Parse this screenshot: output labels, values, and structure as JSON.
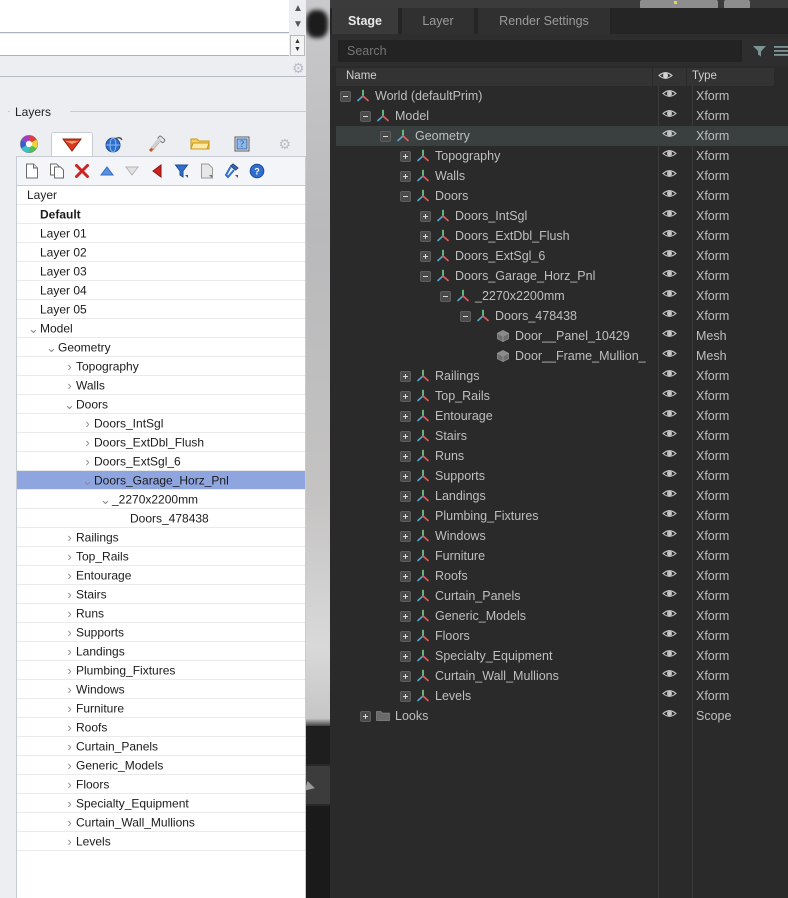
{
  "background": {
    "topbar_button_label": "",
    "secondary_button_label": ""
  },
  "left_panel": {
    "group_title": "Layers",
    "tabs": [
      {
        "name": "color-wheel-tab",
        "icon": "color-wheel-icon",
        "active": false
      },
      {
        "name": "layers-tab",
        "icon": "layers-shield-icon",
        "active": true
      },
      {
        "name": "globe-tab",
        "icon": "globe-icon",
        "active": false
      },
      {
        "name": "paint-tab",
        "icon": "paintbrush-icon",
        "active": false
      },
      {
        "name": "folder-tab",
        "icon": "folder-icon",
        "active": false
      },
      {
        "name": "image-tab",
        "icon": "image-icon",
        "active": false
      },
      {
        "name": "settings-tab",
        "icon": "gear-icon",
        "active": false
      }
    ],
    "toolbar": [
      {
        "name": "new-layer-button",
        "icon": "page-new-icon"
      },
      {
        "name": "duplicate-layer-button",
        "icon": "page-copy-icon"
      },
      {
        "name": "delete-layer-button",
        "icon": "delete-x-icon"
      },
      {
        "name": "move-up-button",
        "icon": "triangle-up-icon"
      },
      {
        "name": "move-down-button",
        "icon": "triangle-down-icon"
      },
      {
        "name": "back-button",
        "icon": "triangle-left-icon"
      },
      {
        "name": "filter-button",
        "icon": "funnel-icon"
      },
      {
        "name": "properties-button",
        "icon": "page-properties-icon"
      },
      {
        "name": "tools-button",
        "icon": "hammer-icon"
      },
      {
        "name": "help-button",
        "icon": "help-question-icon"
      }
    ],
    "column_header": "Layer",
    "rows": [
      {
        "label": "Default",
        "depth": 0,
        "arrow": "none",
        "bold": true,
        "selected": false
      },
      {
        "label": "Layer 01",
        "depth": 0,
        "arrow": "none",
        "bold": false,
        "selected": false
      },
      {
        "label": "Layer 02",
        "depth": 0,
        "arrow": "none",
        "bold": false,
        "selected": false
      },
      {
        "label": "Layer 03",
        "depth": 0,
        "arrow": "none",
        "bold": false,
        "selected": false
      },
      {
        "label": "Layer 04",
        "depth": 0,
        "arrow": "none",
        "bold": false,
        "selected": false
      },
      {
        "label": "Layer 05",
        "depth": 0,
        "arrow": "none",
        "bold": false,
        "selected": false
      },
      {
        "label": "Model",
        "depth": 0,
        "arrow": "expanded",
        "bold": false,
        "selected": false
      },
      {
        "label": "Geometry",
        "depth": 1,
        "arrow": "expanded",
        "bold": false,
        "selected": false
      },
      {
        "label": "Topography",
        "depth": 2,
        "arrow": "collapsed",
        "bold": false,
        "selected": false
      },
      {
        "label": "Walls",
        "depth": 2,
        "arrow": "collapsed",
        "bold": false,
        "selected": false
      },
      {
        "label": "Doors",
        "depth": 2,
        "arrow": "expanded",
        "bold": false,
        "selected": false
      },
      {
        "label": "Doors_IntSgl",
        "depth": 3,
        "arrow": "collapsed",
        "bold": false,
        "selected": false
      },
      {
        "label": "Doors_ExtDbl_Flush",
        "depth": 3,
        "arrow": "collapsed",
        "bold": false,
        "selected": false
      },
      {
        "label": "Doors_ExtSgl_6",
        "depth": 3,
        "arrow": "collapsed",
        "bold": false,
        "selected": false
      },
      {
        "label": "Doors_Garage_Horz_Pnl",
        "depth": 3,
        "arrow": "expanded",
        "bold": false,
        "selected": true
      },
      {
        "label": "_2270x2200mm",
        "depth": 4,
        "arrow": "expanded",
        "bold": false,
        "selected": false
      },
      {
        "label": "Doors_478438",
        "depth": 5,
        "arrow": "none",
        "bold": false,
        "selected": false
      },
      {
        "label": "Railings",
        "depth": 2,
        "arrow": "collapsed",
        "bold": false,
        "selected": false
      },
      {
        "label": "Top_Rails",
        "depth": 2,
        "arrow": "collapsed",
        "bold": false,
        "selected": false
      },
      {
        "label": "Entourage",
        "depth": 2,
        "arrow": "collapsed",
        "bold": false,
        "selected": false
      },
      {
        "label": "Stairs",
        "depth": 2,
        "arrow": "collapsed",
        "bold": false,
        "selected": false
      },
      {
        "label": "Runs",
        "depth": 2,
        "arrow": "collapsed",
        "bold": false,
        "selected": false
      },
      {
        "label": "Supports",
        "depth": 2,
        "arrow": "collapsed",
        "bold": false,
        "selected": false
      },
      {
        "label": "Landings",
        "depth": 2,
        "arrow": "collapsed",
        "bold": false,
        "selected": false
      },
      {
        "label": "Plumbing_Fixtures",
        "depth": 2,
        "arrow": "collapsed",
        "bold": false,
        "selected": false
      },
      {
        "label": "Windows",
        "depth": 2,
        "arrow": "collapsed",
        "bold": false,
        "selected": false
      },
      {
        "label": "Furniture",
        "depth": 2,
        "arrow": "collapsed",
        "bold": false,
        "selected": false
      },
      {
        "label": "Roofs",
        "depth": 2,
        "arrow": "collapsed",
        "bold": false,
        "selected": false
      },
      {
        "label": "Curtain_Panels",
        "depth": 2,
        "arrow": "collapsed",
        "bold": false,
        "selected": false
      },
      {
        "label": "Generic_Models",
        "depth": 2,
        "arrow": "collapsed",
        "bold": false,
        "selected": false
      },
      {
        "label": "Floors",
        "depth": 2,
        "arrow": "collapsed",
        "bold": false,
        "selected": false
      },
      {
        "label": "Specialty_Equipment",
        "depth": 2,
        "arrow": "collapsed",
        "bold": false,
        "selected": false
      },
      {
        "label": "Curtain_Wall_Mullions",
        "depth": 2,
        "arrow": "collapsed",
        "bold": false,
        "selected": false
      },
      {
        "label": "Levels",
        "depth": 2,
        "arrow": "collapsed",
        "bold": false,
        "selected": false
      }
    ]
  },
  "right_panel": {
    "tabs": [
      {
        "label": "Stage",
        "active": true
      },
      {
        "label": "Layer",
        "active": false
      },
      {
        "label": "Render Settings",
        "active": false
      }
    ],
    "search": {
      "value": "",
      "placeholder": "Search"
    },
    "search_icons": [
      {
        "name": "filter-icon"
      },
      {
        "name": "options-menu-icon"
      }
    ],
    "columns": {
      "name": "Name",
      "visibility_icon": "eye-icon",
      "type": "Type"
    },
    "rows": [
      {
        "label": "World (defaultPrim)",
        "type": "Xform",
        "depth": 0,
        "expander": "minus",
        "icon": "xform-axis-icon",
        "selected": false
      },
      {
        "label": "Model",
        "type": "Xform",
        "depth": 1,
        "expander": "minus",
        "icon": "xform-axis-icon",
        "selected": false
      },
      {
        "label": "Geometry",
        "type": "Xform",
        "depth": 2,
        "expander": "minus",
        "icon": "xform-axis-icon",
        "selected": true
      },
      {
        "label": "Topography",
        "type": "Xform",
        "depth": 3,
        "expander": "plus",
        "icon": "xform-axis-icon",
        "selected": false
      },
      {
        "label": "Walls",
        "type": "Xform",
        "depth": 3,
        "expander": "plus",
        "icon": "xform-axis-icon",
        "selected": false
      },
      {
        "label": "Doors",
        "type": "Xform",
        "depth": 3,
        "expander": "minus",
        "icon": "xform-axis-icon",
        "selected": false
      },
      {
        "label": "Doors_IntSgl",
        "type": "Xform",
        "depth": 4,
        "expander": "plus",
        "icon": "xform-axis-icon",
        "selected": false
      },
      {
        "label": "Doors_ExtDbl_Flush",
        "type": "Xform",
        "depth": 4,
        "expander": "plus",
        "icon": "xform-axis-icon",
        "selected": false
      },
      {
        "label": "Doors_ExtSgl_6",
        "type": "Xform",
        "depth": 4,
        "expander": "plus",
        "icon": "xform-axis-icon",
        "selected": false
      },
      {
        "label": "Doors_Garage_Horz_Pnl",
        "type": "Xform",
        "depth": 4,
        "expander": "minus",
        "icon": "xform-axis-icon",
        "selected": false
      },
      {
        "label": "_2270x2200mm",
        "type": "Xform",
        "depth": 5,
        "expander": "minus",
        "icon": "xform-axis-icon",
        "selected": false
      },
      {
        "label": "Doors_478438",
        "type": "Xform",
        "depth": 6,
        "expander": "minus",
        "icon": "xform-axis-icon",
        "selected": false
      },
      {
        "label": "Door__Panel_10429",
        "type": "Mesh",
        "depth": 7,
        "expander": "none",
        "icon": "mesh-cube-icon",
        "selected": false
      },
      {
        "label": "Door__Frame_Mullion_",
        "type": "Mesh",
        "depth": 7,
        "expander": "none",
        "icon": "mesh-cube-icon",
        "selected": false
      },
      {
        "label": "Railings",
        "type": "Xform",
        "depth": 3,
        "expander": "plus",
        "icon": "xform-axis-icon",
        "selected": false
      },
      {
        "label": "Top_Rails",
        "type": "Xform",
        "depth": 3,
        "expander": "plus",
        "icon": "xform-axis-icon",
        "selected": false
      },
      {
        "label": "Entourage",
        "type": "Xform",
        "depth": 3,
        "expander": "plus",
        "icon": "xform-axis-icon",
        "selected": false
      },
      {
        "label": "Stairs",
        "type": "Xform",
        "depth": 3,
        "expander": "plus",
        "icon": "xform-axis-icon",
        "selected": false
      },
      {
        "label": "Runs",
        "type": "Xform",
        "depth": 3,
        "expander": "plus",
        "icon": "xform-axis-icon",
        "selected": false
      },
      {
        "label": "Supports",
        "type": "Xform",
        "depth": 3,
        "expander": "plus",
        "icon": "xform-axis-icon",
        "selected": false
      },
      {
        "label": "Landings",
        "type": "Xform",
        "depth": 3,
        "expander": "plus",
        "icon": "xform-axis-icon",
        "selected": false
      },
      {
        "label": "Plumbing_Fixtures",
        "type": "Xform",
        "depth": 3,
        "expander": "plus",
        "icon": "xform-axis-icon",
        "selected": false
      },
      {
        "label": "Windows",
        "type": "Xform",
        "depth": 3,
        "expander": "plus",
        "icon": "xform-axis-icon",
        "selected": false
      },
      {
        "label": "Furniture",
        "type": "Xform",
        "depth": 3,
        "expander": "plus",
        "icon": "xform-axis-icon",
        "selected": false
      },
      {
        "label": "Roofs",
        "type": "Xform",
        "depth": 3,
        "expander": "plus",
        "icon": "xform-axis-icon",
        "selected": false
      },
      {
        "label": "Curtain_Panels",
        "type": "Xform",
        "depth": 3,
        "expander": "plus",
        "icon": "xform-axis-icon",
        "selected": false
      },
      {
        "label": "Generic_Models",
        "type": "Xform",
        "depth": 3,
        "expander": "plus",
        "icon": "xform-axis-icon",
        "selected": false
      },
      {
        "label": "Floors",
        "type": "Xform",
        "depth": 3,
        "expander": "plus",
        "icon": "xform-axis-icon",
        "selected": false
      },
      {
        "label": "Specialty_Equipment",
        "type": "Xform",
        "depth": 3,
        "expander": "plus",
        "icon": "xform-axis-icon",
        "selected": false
      },
      {
        "label": "Curtain_Wall_Mullions",
        "type": "Xform",
        "depth": 3,
        "expander": "plus",
        "icon": "xform-axis-icon",
        "selected": false
      },
      {
        "label": "Levels",
        "type": "Xform",
        "depth": 3,
        "expander": "plus",
        "icon": "xform-axis-icon",
        "selected": false
      },
      {
        "label": "Looks",
        "type": "Scope",
        "depth": 1,
        "expander": "plus",
        "icon": "folder-icon",
        "selected": false
      }
    ]
  },
  "colors": {
    "selection_blue": "#8fa5e0",
    "dark_bg": "#2a2a2a",
    "row_selected_dark": "#3a3f40",
    "text_light": "#bfbfbf",
    "delete_red": "#cc2222",
    "help_blue": "#2f6fd0"
  }
}
